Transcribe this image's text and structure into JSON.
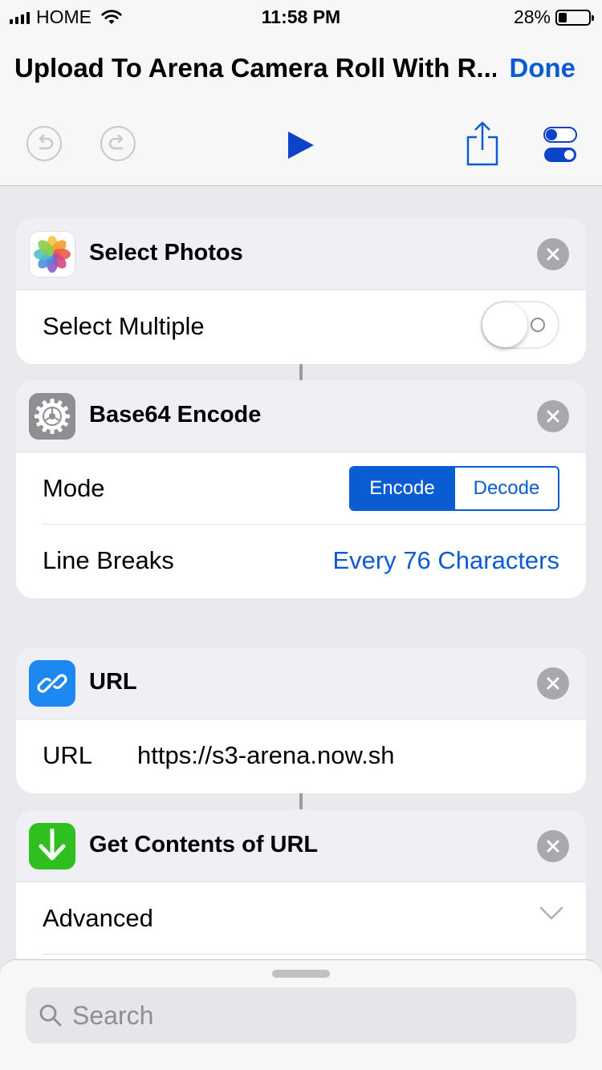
{
  "status_bar": {
    "carrier": "HOME",
    "time": "11:58 PM",
    "battery_percent": "28%",
    "battery_level": 0.28
  },
  "header": {
    "title": "Upload To Arena Camera Roll With R...",
    "done_label": "Done"
  },
  "toolbar": {
    "undo_icon": "undo-icon",
    "redo_icon": "redo-icon",
    "play_icon": "play-icon",
    "share_icon": "share-icon",
    "settings_icon": "settings-toggles-icon",
    "accent": "#0b5bd3"
  },
  "actions": {
    "select_photos": {
      "title": "Select Photos",
      "icon": "photos-app-icon",
      "rows": {
        "select_multiple_label": "Select Multiple",
        "select_multiple_on": false
      }
    },
    "base64": {
      "title": "Base64 Encode",
      "icon": "gear-icon",
      "rows": {
        "mode_label": "Mode",
        "mode_options": [
          "Encode",
          "Decode"
        ],
        "mode_selected": "Encode",
        "line_breaks_label": "Line Breaks",
        "line_breaks_value": "Every 76 Characters"
      }
    },
    "url": {
      "title": "URL",
      "icon": "link-icon",
      "rows": {
        "url_label": "URL",
        "url_value": "https://s3-arena.now.sh"
      }
    },
    "get_contents": {
      "title": "Get Contents of URL",
      "icon": "download-arrow-icon",
      "rows": {
        "advanced_label": "Advanced"
      }
    }
  },
  "bottom_sheet": {
    "search_placeholder": "Search"
  }
}
